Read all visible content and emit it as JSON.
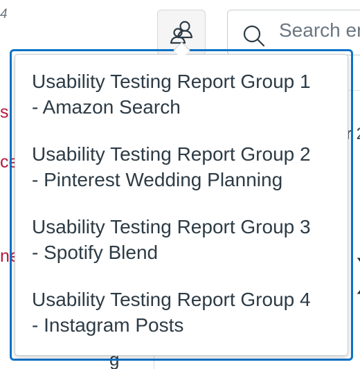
{
  "background": {
    "corner_text": "4",
    "left_fragments": [
      "s",
      "ce",
      "ne"
    ],
    "right_fragments": [
      "r 2"
    ],
    "big_glyph": ")",
    "bottom_glyph": "g"
  },
  "header": {
    "people_icon": "people-icon",
    "search": {
      "icon": "search-icon",
      "placeholder": "Search en"
    }
  },
  "groups_menu": {
    "items": [
      {
        "title": "Usability Testing Report Group 1",
        "subtitle": "- Amazon Search"
      },
      {
        "title": "Usability Testing Report Group 2",
        "subtitle": "- Pinterest Wedding Planning"
      },
      {
        "title": "Usability Testing Report Group 3",
        "subtitle": "- Spotify Blend"
      },
      {
        "title": "Usability Testing Report Group 4",
        "subtitle": "- Instagram Posts"
      }
    ]
  },
  "colors": {
    "focus_ring": "#0c72c7",
    "text": "#2d3b45",
    "link_red": "#b41a3a"
  }
}
